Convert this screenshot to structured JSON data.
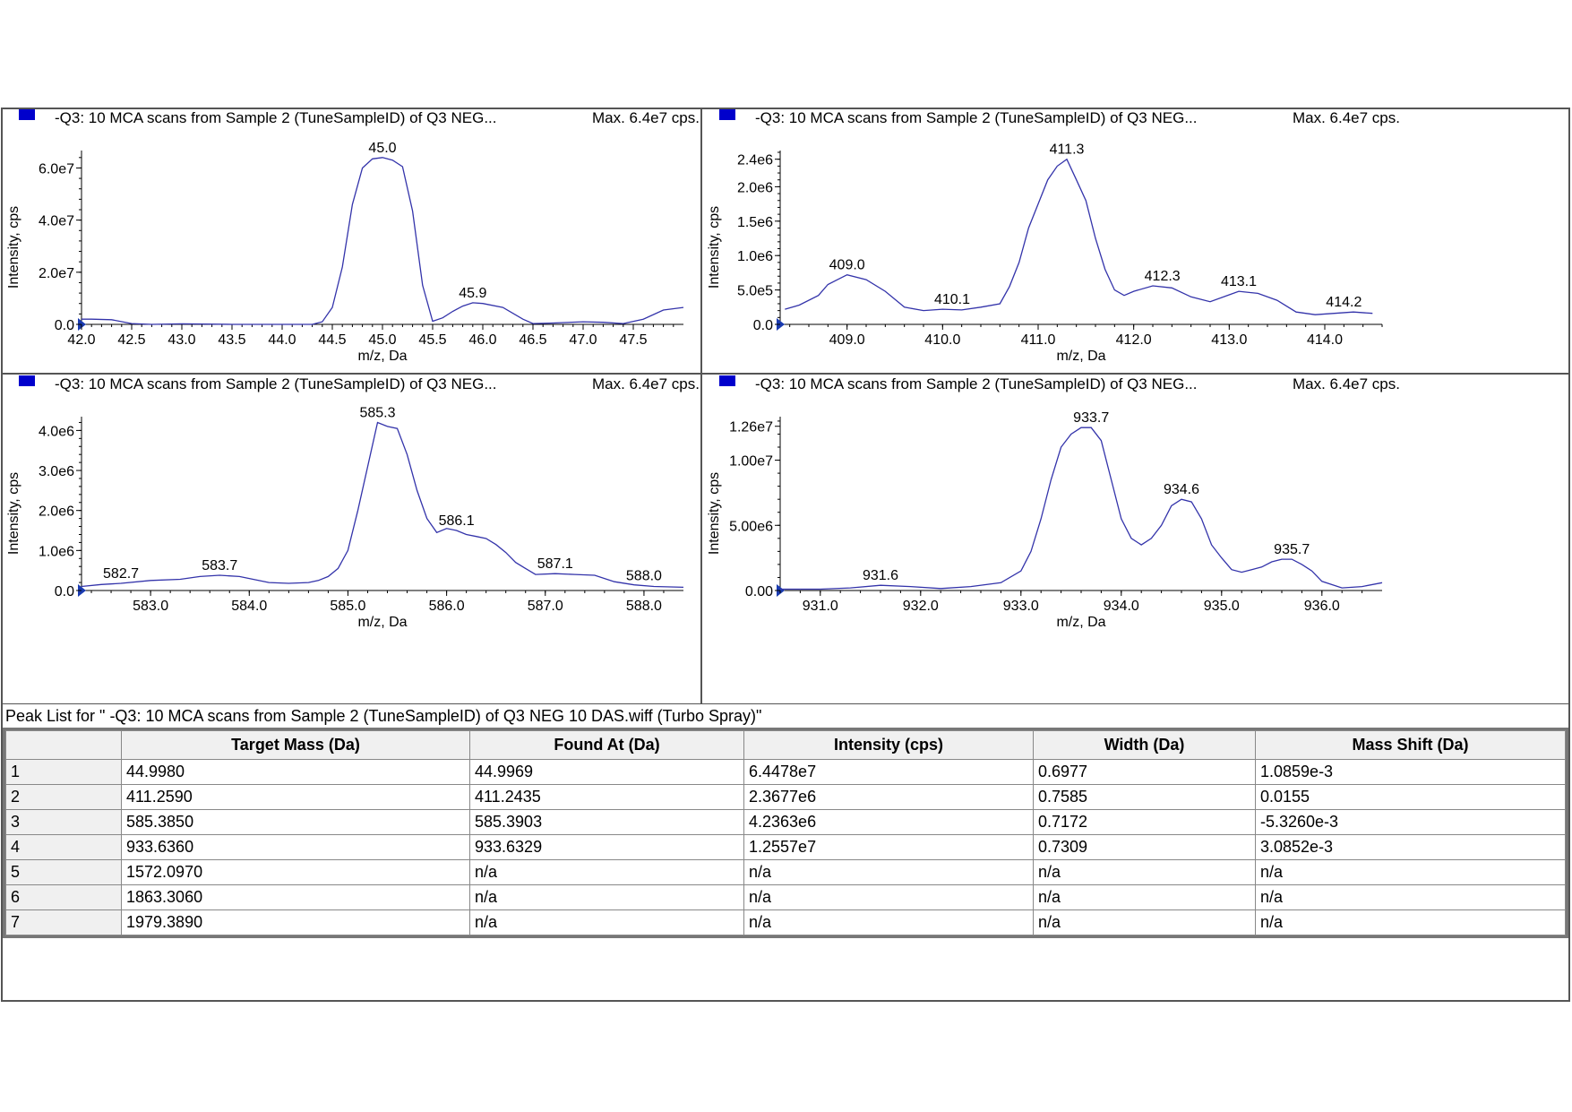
{
  "panels_header": {
    "title": "-Q3: 10 MCA scans from Sample 2 (TuneSampleID) of Q3 NEG...",
    "max_label": "Max. 6.4e7 cps.",
    "marker_color": "#0000cc"
  },
  "chart_data": [
    {
      "type": "line",
      "title": "-Q3: 10 MCA scans from Sample 2 (TuneSampleID) of Q3 NEG...",
      "max_label": "Max. 6.4e7 cps.",
      "xlabel": "m/z, Da",
      "ylabel": "Intensity, cps",
      "xlim": [
        42.0,
        48.0
      ],
      "ylim": [
        0,
        66000000.0
      ],
      "xticks": [
        "42.0",
        "42.5",
        "43.0",
        "43.5",
        "44.0",
        "44.5",
        "45.0",
        "45.5",
        "46.0",
        "46.5",
        "47.0",
        "47.5"
      ],
      "xtick_values": [
        42.0,
        42.5,
        43.0,
        43.5,
        44.0,
        44.5,
        45.0,
        45.5,
        46.0,
        46.5,
        47.0,
        47.5
      ],
      "yticks": [
        "0.0",
        "2.0e7",
        "4.0e7",
        "6.0e7"
      ],
      "ytick_values": [
        0,
        20000000.0,
        40000000.0,
        60000000.0
      ],
      "line_color": "#3333aa",
      "x": [
        42.0,
        42.1,
        42.3,
        42.5,
        42.7,
        43.0,
        43.5,
        44.0,
        44.3,
        44.4,
        44.5,
        44.6,
        44.7,
        44.8,
        44.9,
        45.0,
        45.1,
        45.2,
        45.3,
        45.4,
        45.5,
        45.6,
        45.7,
        45.8,
        45.9,
        46.0,
        46.2,
        46.4,
        46.5,
        46.7,
        47.0,
        47.2,
        47.4,
        47.6,
        47.8,
        48.0
      ],
      "y": [
        2000000.0,
        2000000.0,
        1800000.0,
        300000.0,
        0,
        200000.0,
        0,
        0,
        0,
        1000000.0,
        6500000.0,
        22000000.0,
        46000000.0,
        60000000.0,
        63500000.0,
        64000000.0,
        63000000.0,
        60500000.0,
        43500000.0,
        15000000.0,
        1200000.0,
        2500000.0,
        5000000.0,
        7000000.0,
        8300000.0,
        8000000.0,
        6500000.0,
        2000000.0,
        300000.0,
        500000.0,
        1000000.0,
        800000.0,
        300000.0,
        2000000.0,
        5500000.0,
        6500000.0
      ],
      "peak_labels": [
        {
          "x": 45.0,
          "y": 64000000.0,
          "text": "45.0"
        },
        {
          "x": 45.9,
          "y": 8300000.0,
          "text": "45.9"
        }
      ]
    },
    {
      "type": "line",
      "title": "-Q3: 10 MCA scans from Sample 2 (TuneSampleID) of Q3 NEG...",
      "max_label": "Max. 6.4e7 cps.",
      "xlabel": "m/z, Da",
      "ylabel": "Intensity, cps",
      "xlim": [
        408.3,
        414.6
      ],
      "ylim": [
        0,
        2500000.0
      ],
      "xticks": [
        "409.0",
        "410.0",
        "411.0",
        "412.0",
        "413.0",
        "414.0"
      ],
      "xtick_values": [
        409.0,
        410.0,
        411.0,
        412.0,
        413.0,
        414.0
      ],
      "yticks": [
        "0.0",
        "5.0e5",
        "1.0e6",
        "1.5e6",
        "2.0e6",
        "2.4e6"
      ],
      "ytick_values": [
        0,
        500000.0,
        1000000.0,
        1500000.0,
        2000000.0,
        2400000.0
      ],
      "line_color": "#3333aa",
      "x": [
        408.35,
        408.5,
        408.7,
        408.8,
        408.9,
        409.0,
        409.2,
        409.4,
        409.6,
        409.8,
        410.0,
        410.2,
        410.4,
        410.6,
        410.7,
        410.8,
        410.9,
        411.0,
        411.1,
        411.2,
        411.3,
        411.4,
        411.5,
        411.6,
        411.7,
        411.8,
        411.9,
        412.0,
        412.2,
        412.4,
        412.6,
        412.8,
        413.0,
        413.1,
        413.3,
        413.5,
        413.7,
        413.9,
        414.1,
        414.3,
        414.5
      ],
      "y": [
        220000.0,
        280000.0,
        420000.0,
        580000.0,
        650000.0,
        720000.0,
        650000.0,
        480000.0,
        250000.0,
        200000.0,
        220000.0,
        210000.0,
        250000.0,
        300000.0,
        550000.0,
        900000.0,
        1400000.0,
        1750000.0,
        2100000.0,
        2300000.0,
        2400000.0,
        2100000.0,
        1800000.0,
        1250000.0,
        800000.0,
        500000.0,
        420000.0,
        480000.0,
        560000.0,
        530000.0,
        400000.0,
        330000.0,
        430000.0,
        480000.0,
        450000.0,
        350000.0,
        180000.0,
        140000.0,
        160000.0,
        180000.0,
        160000.0
      ],
      "peak_labels": [
        {
          "x": 409.0,
          "y": 720000.0,
          "text": "409.0"
        },
        {
          "x": 410.1,
          "y": 220000.0,
          "text": "410.1"
        },
        {
          "x": 411.3,
          "y": 2400000.0,
          "text": "411.3"
        },
        {
          "x": 412.3,
          "y": 560000.0,
          "text": "412.3"
        },
        {
          "x": 413.1,
          "y": 480000.0,
          "text": "413.1"
        },
        {
          "x": 414.2,
          "y": 180000.0,
          "text": "414.2"
        }
      ]
    },
    {
      "type": "line",
      "title": "-Q3: 10 MCA scans from Sample 2 (TuneSampleID) of Q3 NEG...",
      "max_label": "Max. 6.4e7 cps.",
      "xlabel": "m/z, Da",
      "ylabel": "Intensity, cps",
      "xlim": [
        582.3,
        588.4
      ],
      "ylim": [
        0,
        4300000.0
      ],
      "xticks": [
        "583.0",
        "584.0",
        "585.0",
        "586.0",
        "587.0",
        "588.0"
      ],
      "xtick_values": [
        583.0,
        584.0,
        585.0,
        586.0,
        587.0,
        588.0
      ],
      "yticks": [
        "0.0",
        "1.0e6",
        "2.0e6",
        "3.0e6",
        "4.0e6"
      ],
      "ytick_values": [
        0,
        1000000.0,
        2000000.0,
        3000000.0,
        4000000.0
      ],
      "line_color": "#3333aa",
      "x": [
        582.3,
        582.5,
        582.7,
        583.0,
        583.3,
        583.5,
        583.7,
        583.9,
        584.0,
        584.2,
        584.4,
        584.6,
        584.7,
        584.8,
        584.9,
        585.0,
        585.1,
        585.2,
        585.3,
        585.4,
        585.5,
        585.6,
        585.7,
        585.8,
        585.9,
        586.0,
        586.1,
        586.2,
        586.3,
        586.4,
        586.5,
        586.6,
        586.7,
        586.8,
        586.9,
        587.1,
        587.3,
        587.5,
        587.7,
        587.9,
        588.1,
        588.4
      ],
      "y": [
        100000.0,
        150000.0,
        180000.0,
        250000.0,
        280000.0,
        350000.0,
        380000.0,
        350000.0,
        300000.0,
        200000.0,
        180000.0,
        200000.0,
        250000.0,
        350000.0,
        550000.0,
        1000000.0,
        2000000.0,
        3100000.0,
        4200000.0,
        4100000.0,
        4050000.0,
        3400000.0,
        2500000.0,
        1800000.0,
        1450000.0,
        1550000.0,
        1500000.0,
        1400000.0,
        1350000.0,
        1300000.0,
        1150000.0,
        950000.0,
        700000.0,
        550000.0,
        400000.0,
        420000.0,
        400000.0,
        380000.0,
        220000.0,
        140000.0,
        100000.0,
        80000.0
      ],
      "peak_labels": [
        {
          "x": 582.7,
          "y": 180000.0,
          "text": "582.7"
        },
        {
          "x": 583.7,
          "y": 380000.0,
          "text": "583.7"
        },
        {
          "x": 585.3,
          "y": 4200000.0,
          "text": "585.3"
        },
        {
          "x": 586.1,
          "y": 1500000.0,
          "text": "586.1"
        },
        {
          "x": 587.1,
          "y": 420000.0,
          "text": "587.1"
        },
        {
          "x": 588.0,
          "y": 120000.0,
          "text": "588.0"
        }
      ]
    },
    {
      "type": "line",
      "title": "-Q3: 10 MCA scans from Sample 2 (TuneSampleID) of Q3 NEG...",
      "max_label": "Max. 6.4e7 cps.",
      "xlabel": "m/z, Da",
      "ylabel": "Intensity, cps",
      "xlim": [
        930.6,
        936.6
      ],
      "ylim": [
        0,
        13200000.0
      ],
      "xticks": [
        "931.0",
        "932.0",
        "933.0",
        "934.0",
        "935.0",
        "936.0"
      ],
      "xtick_values": [
        931.0,
        932.0,
        933.0,
        934.0,
        935.0,
        936.0
      ],
      "yticks": [
        "0.00",
        "5.00e6",
        "1.00e7",
        "1.26e7"
      ],
      "ytick_values": [
        0,
        5000000.0,
        10000000.0,
        12600000.0
      ],
      "line_color": "#3333aa",
      "x": [
        930.6,
        931.0,
        931.3,
        931.6,
        931.9,
        932.2,
        932.5,
        932.8,
        933.0,
        933.1,
        933.2,
        933.3,
        933.4,
        933.5,
        933.6,
        933.7,
        933.8,
        933.9,
        934.0,
        934.1,
        934.2,
        934.3,
        934.4,
        934.5,
        934.6,
        934.7,
        934.8,
        934.9,
        935.0,
        935.1,
        935.2,
        935.3,
        935.4,
        935.5,
        935.6,
        935.7,
        935.8,
        935.9,
        936.0,
        936.2,
        936.4,
        936.6
      ],
      "y": [
        100000.0,
        100000.0,
        200000.0,
        400000.0,
        300000.0,
        150000.0,
        300000.0,
        600000.0,
        1500000.0,
        3000000.0,
        5500000.0,
        8500000.0,
        11000000.0,
        12000000.0,
        12500000.0,
        12500000.0,
        11500000.0,
        8500000.0,
        5500000.0,
        4000000.0,
        3500000.0,
        4000000.0,
        5000000.0,
        6500000.0,
        7000000.0,
        6800000.0,
        5500000.0,
        3500000.0,
        2500000.0,
        1600000.0,
        1400000.0,
        1600000.0,
        1800000.0,
        2200000.0,
        2400000.0,
        2400000.0,
        2000000.0,
        1500000.0,
        700000.0,
        200000.0,
        300000.0,
        600000.0
      ],
      "peak_labels": [
        {
          "x": 931.6,
          "y": 400000.0,
          "text": "931.6"
        },
        {
          "x": 933.7,
          "y": 12500000.0,
          "text": "933.7"
        },
        {
          "x": 934.6,
          "y": 7000000.0,
          "text": "934.6"
        },
        {
          "x": 935.7,
          "y": 2400000.0,
          "text": "935.7"
        }
      ]
    }
  ],
  "peak_list": {
    "title": "Peak List for \" -Q3: 10 MCA scans from Sample 2 (TuneSampleID) of Q3 NEG 10 DAS.wiff (Turbo Spray)\"",
    "headers": [
      "",
      "Target Mass (Da)",
      "Found At (Da)",
      "Intensity (cps)",
      "Width (Da)",
      "Mass Shift (Da)"
    ],
    "rows": [
      [
        "1",
        "44.9980",
        "44.9969",
        "6.4478e7",
        "0.6977",
        "1.0859e-3"
      ],
      [
        "2",
        "411.2590",
        "411.2435",
        "2.3677e6",
        "0.7585",
        "0.0155"
      ],
      [
        "3",
        "585.3850",
        "585.3903",
        "4.2363e6",
        "0.7172",
        "-5.3260e-3"
      ],
      [
        "4",
        "933.6360",
        "933.6329",
        "1.2557e7",
        "0.7309",
        "3.0852e-3"
      ],
      [
        "5",
        "1572.0970",
        "n/a",
        "n/a",
        "n/a",
        "n/a"
      ],
      [
        "6",
        "1863.3060",
        "n/a",
        "n/a",
        "n/a",
        "n/a"
      ],
      [
        "7",
        "1979.3890",
        "n/a",
        "n/a",
        "n/a",
        "n/a"
      ]
    ]
  }
}
